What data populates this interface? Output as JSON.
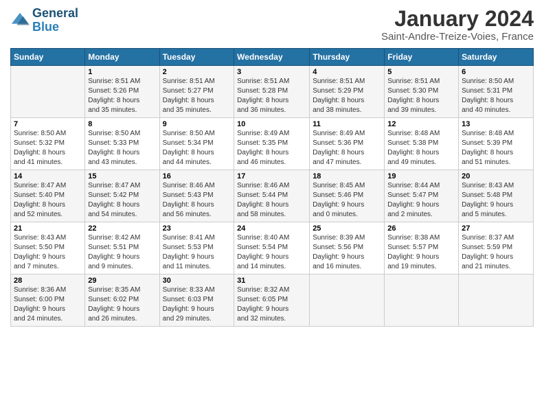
{
  "logo": {
    "text1": "General",
    "text2": "Blue"
  },
  "title": "January 2024",
  "subtitle": "Saint-Andre-Treize-Voies, France",
  "days_of_week": [
    "Sunday",
    "Monday",
    "Tuesday",
    "Wednesday",
    "Thursday",
    "Friday",
    "Saturday"
  ],
  "weeks": [
    [
      {
        "num": "",
        "sunrise": "",
        "sunset": "",
        "daylight": ""
      },
      {
        "num": "1",
        "sunrise": "Sunrise: 8:51 AM",
        "sunset": "Sunset: 5:26 PM",
        "daylight": "Daylight: 8 hours and 35 minutes."
      },
      {
        "num": "2",
        "sunrise": "Sunrise: 8:51 AM",
        "sunset": "Sunset: 5:27 PM",
        "daylight": "Daylight: 8 hours and 35 minutes."
      },
      {
        "num": "3",
        "sunrise": "Sunrise: 8:51 AM",
        "sunset": "Sunset: 5:28 PM",
        "daylight": "Daylight: 8 hours and 36 minutes."
      },
      {
        "num": "4",
        "sunrise": "Sunrise: 8:51 AM",
        "sunset": "Sunset: 5:29 PM",
        "daylight": "Daylight: 8 hours and 38 minutes."
      },
      {
        "num": "5",
        "sunrise": "Sunrise: 8:51 AM",
        "sunset": "Sunset: 5:30 PM",
        "daylight": "Daylight: 8 hours and 39 minutes."
      },
      {
        "num": "6",
        "sunrise": "Sunrise: 8:50 AM",
        "sunset": "Sunset: 5:31 PM",
        "daylight": "Daylight: 8 hours and 40 minutes."
      }
    ],
    [
      {
        "num": "7",
        "sunrise": "Sunrise: 8:50 AM",
        "sunset": "Sunset: 5:32 PM",
        "daylight": "Daylight: 8 hours and 41 minutes."
      },
      {
        "num": "8",
        "sunrise": "Sunrise: 8:50 AM",
        "sunset": "Sunset: 5:33 PM",
        "daylight": "Daylight: 8 hours and 43 minutes."
      },
      {
        "num": "9",
        "sunrise": "Sunrise: 8:50 AM",
        "sunset": "Sunset: 5:34 PM",
        "daylight": "Daylight: 8 hours and 44 minutes."
      },
      {
        "num": "10",
        "sunrise": "Sunrise: 8:49 AM",
        "sunset": "Sunset: 5:35 PM",
        "daylight": "Daylight: 8 hours and 46 minutes."
      },
      {
        "num": "11",
        "sunrise": "Sunrise: 8:49 AM",
        "sunset": "Sunset: 5:36 PM",
        "daylight": "Daylight: 8 hours and 47 minutes."
      },
      {
        "num": "12",
        "sunrise": "Sunrise: 8:48 AM",
        "sunset": "Sunset: 5:38 PM",
        "daylight": "Daylight: 8 hours and 49 minutes."
      },
      {
        "num": "13",
        "sunrise": "Sunrise: 8:48 AM",
        "sunset": "Sunset: 5:39 PM",
        "daylight": "Daylight: 8 hours and 51 minutes."
      }
    ],
    [
      {
        "num": "14",
        "sunrise": "Sunrise: 8:47 AM",
        "sunset": "Sunset: 5:40 PM",
        "daylight": "Daylight: 8 hours and 52 minutes."
      },
      {
        "num": "15",
        "sunrise": "Sunrise: 8:47 AM",
        "sunset": "Sunset: 5:42 PM",
        "daylight": "Daylight: 8 hours and 54 minutes."
      },
      {
        "num": "16",
        "sunrise": "Sunrise: 8:46 AM",
        "sunset": "Sunset: 5:43 PM",
        "daylight": "Daylight: 8 hours and 56 minutes."
      },
      {
        "num": "17",
        "sunrise": "Sunrise: 8:46 AM",
        "sunset": "Sunset: 5:44 PM",
        "daylight": "Daylight: 8 hours and 58 minutes."
      },
      {
        "num": "18",
        "sunrise": "Sunrise: 8:45 AM",
        "sunset": "Sunset: 5:46 PM",
        "daylight": "Daylight: 9 hours and 0 minutes."
      },
      {
        "num": "19",
        "sunrise": "Sunrise: 8:44 AM",
        "sunset": "Sunset: 5:47 PM",
        "daylight": "Daylight: 9 hours and 2 minutes."
      },
      {
        "num": "20",
        "sunrise": "Sunrise: 8:43 AM",
        "sunset": "Sunset: 5:48 PM",
        "daylight": "Daylight: 9 hours and 5 minutes."
      }
    ],
    [
      {
        "num": "21",
        "sunrise": "Sunrise: 8:43 AM",
        "sunset": "Sunset: 5:50 PM",
        "daylight": "Daylight: 9 hours and 7 minutes."
      },
      {
        "num": "22",
        "sunrise": "Sunrise: 8:42 AM",
        "sunset": "Sunset: 5:51 PM",
        "daylight": "Daylight: 9 hours and 9 minutes."
      },
      {
        "num": "23",
        "sunrise": "Sunrise: 8:41 AM",
        "sunset": "Sunset: 5:53 PM",
        "daylight": "Daylight: 9 hours and 11 minutes."
      },
      {
        "num": "24",
        "sunrise": "Sunrise: 8:40 AM",
        "sunset": "Sunset: 5:54 PM",
        "daylight": "Daylight: 9 hours and 14 minutes."
      },
      {
        "num": "25",
        "sunrise": "Sunrise: 8:39 AM",
        "sunset": "Sunset: 5:56 PM",
        "daylight": "Daylight: 9 hours and 16 minutes."
      },
      {
        "num": "26",
        "sunrise": "Sunrise: 8:38 AM",
        "sunset": "Sunset: 5:57 PM",
        "daylight": "Daylight: 9 hours and 19 minutes."
      },
      {
        "num": "27",
        "sunrise": "Sunrise: 8:37 AM",
        "sunset": "Sunset: 5:59 PM",
        "daylight": "Daylight: 9 hours and 21 minutes."
      }
    ],
    [
      {
        "num": "28",
        "sunrise": "Sunrise: 8:36 AM",
        "sunset": "Sunset: 6:00 PM",
        "daylight": "Daylight: 9 hours and 24 minutes."
      },
      {
        "num": "29",
        "sunrise": "Sunrise: 8:35 AM",
        "sunset": "Sunset: 6:02 PM",
        "daylight": "Daylight: 9 hours and 26 minutes."
      },
      {
        "num": "30",
        "sunrise": "Sunrise: 8:33 AM",
        "sunset": "Sunset: 6:03 PM",
        "daylight": "Daylight: 9 hours and 29 minutes."
      },
      {
        "num": "31",
        "sunrise": "Sunrise: 8:32 AM",
        "sunset": "Sunset: 6:05 PM",
        "daylight": "Daylight: 9 hours and 32 minutes."
      },
      {
        "num": "",
        "sunrise": "",
        "sunset": "",
        "daylight": ""
      },
      {
        "num": "",
        "sunrise": "",
        "sunset": "",
        "daylight": ""
      },
      {
        "num": "",
        "sunrise": "",
        "sunset": "",
        "daylight": ""
      }
    ]
  ]
}
